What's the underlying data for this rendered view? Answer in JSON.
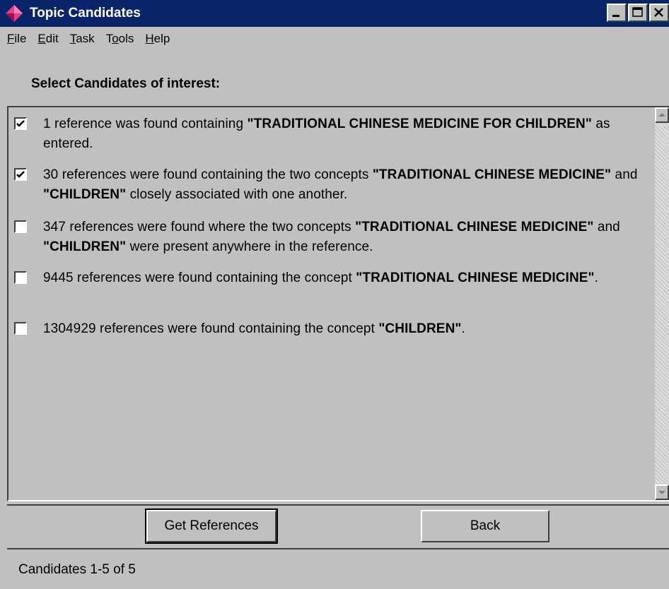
{
  "window": {
    "title": "Topic Candidates",
    "title_bar_color": "#0a246a",
    "app_icon": "diamond-app-icon"
  },
  "menu": [
    {
      "label": "File",
      "underline_index": 0
    },
    {
      "label": "Edit",
      "underline_index": 0
    },
    {
      "label": "Task",
      "underline_index": 0
    },
    {
      "label": "Tools",
      "underline_index": 1
    },
    {
      "label": "Help",
      "underline_index": 0
    }
  ],
  "heading": "Select Candidates of interest:",
  "candidates": [
    {
      "checked": true,
      "segments": [
        {
          "text": "1 reference was found containing ",
          "bold": false
        },
        {
          "text": "\"TRADITIONAL CHINESE MEDICINE FOR CHILDREN\"",
          "bold": true
        },
        {
          "text": " as entered.",
          "bold": false
        }
      ]
    },
    {
      "checked": true,
      "segments": [
        {
          "text": "30 references were found containing the two concepts ",
          "bold": false
        },
        {
          "text": "\"TRADITIONAL CHINESE MEDICINE\"",
          "bold": true
        },
        {
          "text": " and ",
          "bold": false
        },
        {
          "text": "\"CHILDREN\"",
          "bold": true
        },
        {
          "text": " closely associated with one another.",
          "bold": false
        }
      ]
    },
    {
      "checked": false,
      "segments": [
        {
          "text": "347 references were found where the two concepts ",
          "bold": false
        },
        {
          "text": "\"TRADITIONAL CHINESE MEDICINE\"",
          "bold": true
        },
        {
          "text": " and ",
          "bold": false
        },
        {
          "text": "\"CHILDREN\"",
          "bold": true
        },
        {
          "text": " were present anywhere in the reference.",
          "bold": false
        }
      ]
    },
    {
      "checked": false,
      "segments": [
        {
          "text": "9445 references were found containing the concept ",
          "bold": false
        },
        {
          "text": "\"TRADITIONAL CHINESE MEDICINE\"",
          "bold": true
        },
        {
          "text": ".",
          "bold": false
        }
      ]
    },
    {
      "checked": false,
      "segments": [
        {
          "text": "1304929 references were found containing the concept ",
          "bold": false
        },
        {
          "text": "\"CHILDREN\"",
          "bold": true
        },
        {
          "text": ".",
          "bold": false
        }
      ]
    }
  ],
  "buttons": {
    "get_references": "Get References",
    "back": "Back"
  },
  "status": "Candidates 1-5 of 5"
}
